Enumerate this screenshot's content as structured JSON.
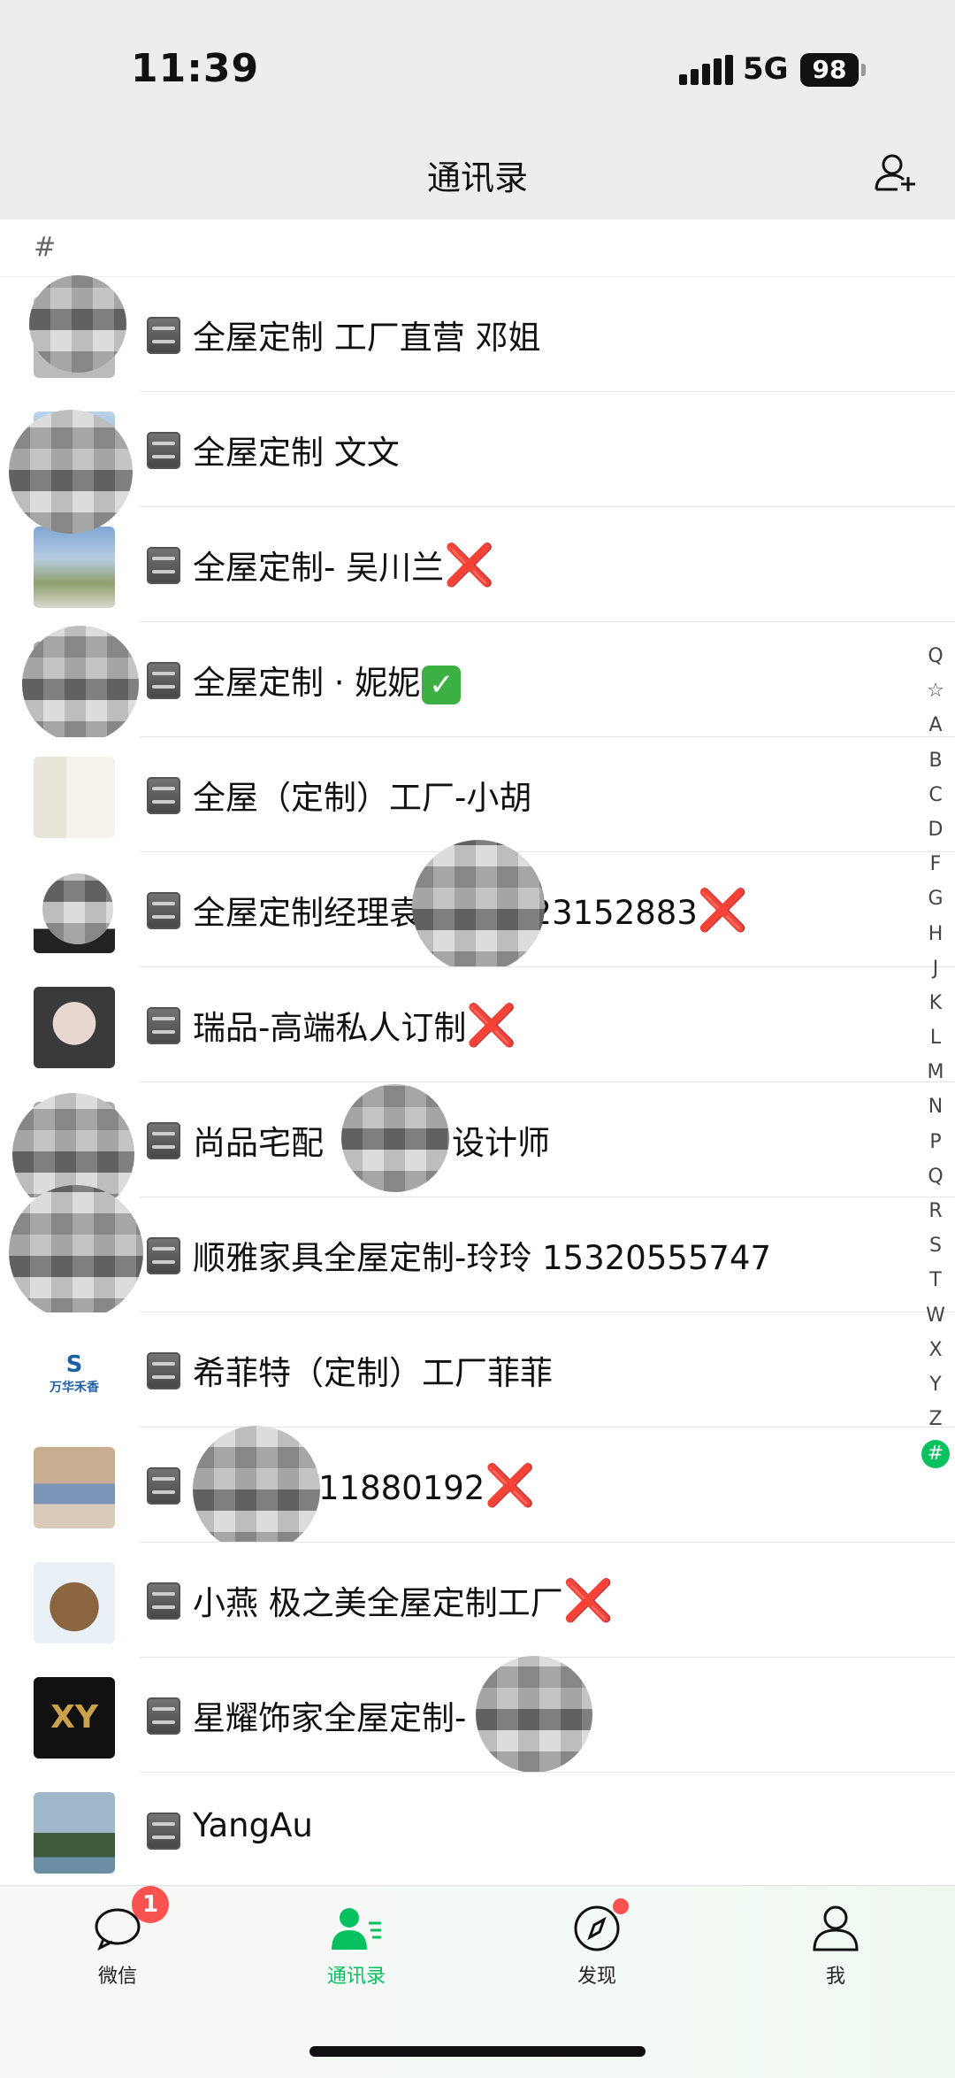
{
  "status_bar": {
    "time": "11:39",
    "network": "5G",
    "battery": "98"
  },
  "nav": {
    "title": "通讯录",
    "add_friend_icon": "add-contact-icon"
  },
  "section_header": "#",
  "contacts": [
    {
      "name": "全屋定制 工厂直营 邓姐",
      "mark": ""
    },
    {
      "name": "全屋定制 文文",
      "mark": ""
    },
    {
      "name": "全屋定制- 吴川兰",
      "mark": "❌"
    },
    {
      "name": "全屋定制 · 妮妮",
      "mark": "✅"
    },
    {
      "name": "全屋（定制）工厂-小胡",
      "mark": ""
    },
    {
      "name": "全屋定制经理袁",
      "suffix": "123152883",
      "mark": "❌"
    },
    {
      "name": "瑞品-高端私人订制",
      "mark": "❌"
    },
    {
      "name": "尚品宅配",
      "suffix": "设计师",
      "mark": ""
    },
    {
      "name": "顺雅家具全屋定制-玲玲 15320555747",
      "mark": ""
    },
    {
      "name": "希菲特（定制）工厂菲菲",
      "mark": ""
    },
    {
      "name": "",
      "suffix": "11880192",
      "mark": "❌"
    },
    {
      "name": "小燕 极之美全屋定制工厂",
      "mark": "❌"
    },
    {
      "name": "星耀饰家全屋定制-",
      "mark": ""
    },
    {
      "name": "YangAu",
      "mark": ""
    }
  ],
  "avatar_texts": {
    "wanhua": "万华禾香",
    "xy": "XY"
  },
  "index_bar": [
    "Q",
    "☆",
    "A",
    "B",
    "C",
    "D",
    "F",
    "G",
    "H",
    "J",
    "K",
    "L",
    "M",
    "N",
    "P",
    "Q",
    "R",
    "S",
    "T",
    "W",
    "X",
    "Y",
    "Z",
    "#"
  ],
  "tabs": [
    {
      "label": "微信",
      "badge": "1"
    },
    {
      "label": "通讯录"
    },
    {
      "label": "发现"
    },
    {
      "label": "我"
    }
  ],
  "colors": {
    "accent": "#07c160",
    "badge": "#fa5151",
    "nav_bg": "#ededed"
  }
}
